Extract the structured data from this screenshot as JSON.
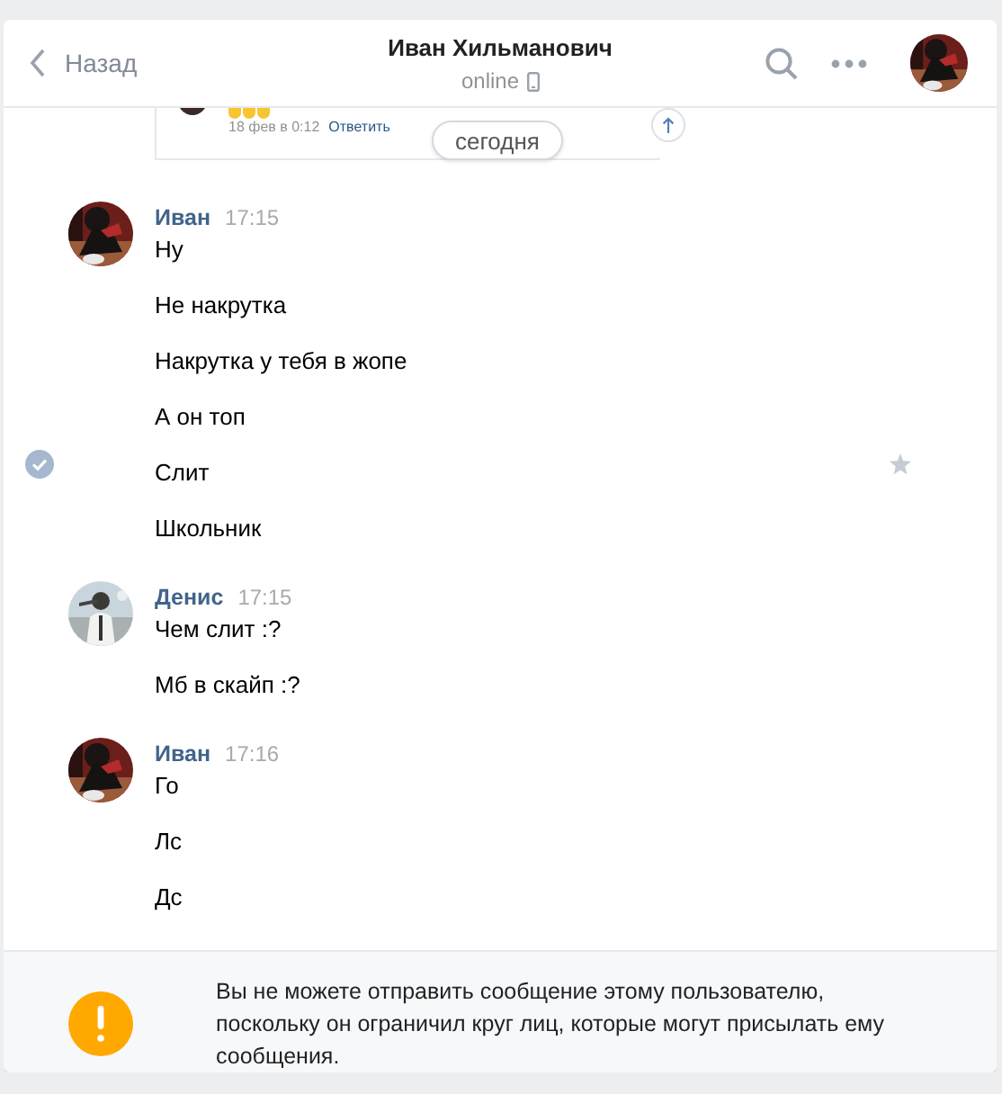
{
  "header": {
    "back_label": "Назад",
    "title": "Иван Хильманович",
    "status": "online"
  },
  "history_preview": {
    "date": "18 фев в 0:12",
    "reply_link": "Ответить"
  },
  "date_pill": "сегодня",
  "groups": [
    {
      "author": "Иван",
      "time": "17:15",
      "messages": [
        {
          "text": "Ну",
          "selected": false
        },
        {
          "text": "Не накрутка",
          "selected": false
        },
        {
          "text": "Накрутка у тебя в жопе",
          "selected": false
        },
        {
          "text": "А он топ",
          "selected": false
        },
        {
          "text": "Слит",
          "selected": true
        },
        {
          "text": "Школьник",
          "selected": false
        }
      ]
    },
    {
      "author": "Денис",
      "time": "17:15",
      "messages": [
        {
          "text": "Чем слит :?",
          "selected": false
        },
        {
          "text": "Мб в скайп :?",
          "selected": false
        }
      ]
    },
    {
      "author": "Иван",
      "time": "17:16",
      "messages": [
        {
          "text": "Го",
          "selected": false
        },
        {
          "text": "Лс",
          "selected": false
        },
        {
          "text": "Дс",
          "selected": false
        }
      ]
    }
  ],
  "notice": "Вы не можете отправить сообщение этому пользователю, поскольку он ограничил круг лиц, которые могут присылать ему сообщения."
}
